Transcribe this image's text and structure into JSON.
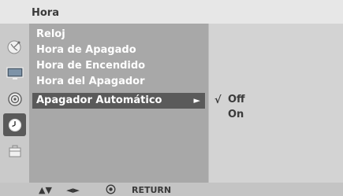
{
  "header": {
    "title": "Hora"
  },
  "sidebar": {
    "icons": [
      "satellite-dish-icon",
      "monitor-icon",
      "speaker-icon",
      "clock-icon",
      "toolbox-icon"
    ],
    "active_index": 3
  },
  "menu": {
    "items": [
      {
        "label": "Reloj"
      },
      {
        "label": "Hora de Apagado"
      },
      {
        "label": "Hora de Encendido"
      },
      {
        "label": "Hora del Apagador"
      },
      {
        "label": "Apagador Automático"
      }
    ],
    "selected_index": 4,
    "submenu_arrow": "►"
  },
  "submenu": {
    "check_mark": "√",
    "options": [
      {
        "label": "Off"
      },
      {
        "label": "On"
      }
    ],
    "checked_index": 0
  },
  "footer": {
    "nav_updown": "▲▼",
    "nav_leftright": "◄►",
    "return_label": "RETURN"
  }
}
